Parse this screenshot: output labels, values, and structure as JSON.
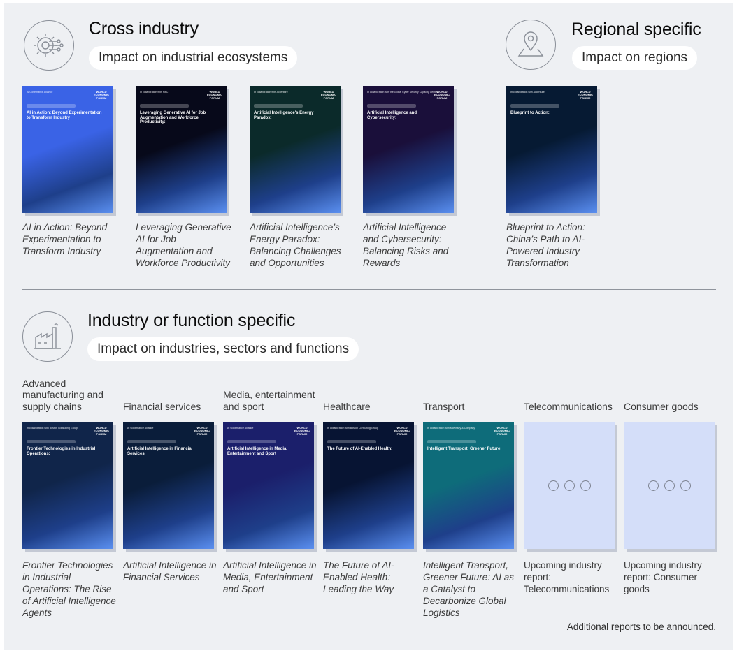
{
  "cross": {
    "title": "Cross industry",
    "subtitle": "Impact on industrial ecosystems",
    "icon": "gear-network-icon",
    "reports": [
      {
        "caption": "AI in Action: Beyond Experimentation to Transform Industry",
        "cover_head": "AI in Action: Beyond Experimentation to Transform Industry",
        "cover_small": "AI Governance Alliance",
        "bg": "#3a63e6"
      },
      {
        "caption": "Leveraging Generative AI for Job Augmentation and Workforce Productivity",
        "cover_head": "Leveraging Generative AI for Job Augmentation and Workforce Productivity:",
        "cover_small": "In collaboration with PwC",
        "bg": "#07091a"
      },
      {
        "caption": "Artificial Intelligence’s Energy Paradox: Balancing Challenges and Opportunities",
        "cover_head": "Artificial Intelligence’s Energy Paradox:",
        "cover_small": "In collaboration with Accenture",
        "bg": "#0b2a2a"
      },
      {
        "caption": "Artificial Intelligence and Cybersecurity: Balancing Risks and Rewards",
        "cover_head": "Artificial Intelligence and Cybersecurity:",
        "cover_small": "In collaboration with the Global Cyber Security Capacity Centre",
        "bg": "#1a0f3a"
      }
    ]
  },
  "regional": {
    "title": "Regional specific",
    "subtitle": "Impact on regions",
    "icon": "map-pin-icon",
    "reports": [
      {
        "caption": "Blueprint to Action: China’s Path to AI-Powered Industry Transformation",
        "cover_head": "Blueprint to Action:",
        "cover_small": "In collaboration with Accenture",
        "bg": "#061a33"
      }
    ]
  },
  "industry": {
    "title": "Industry or function specific",
    "subtitle": "Impact on industries, sectors and functions",
    "icon": "factory-icon",
    "columns": [
      {
        "heading": "Advanced manufacturing and supply chains",
        "caption": "Frontier Technologies in Industrial Operations: The Rise of Artificial Intelligence Agents",
        "cover_head": "Frontier Technologies in Industrial Operations:",
        "cover_small": "In collaboration with Boston Consulting Group",
        "bg": "#10254a",
        "upcoming": false
      },
      {
        "heading": "Financial services",
        "caption": "Artificial Intelligence in Financial Services",
        "cover_head": "Artificial Intelligence in Financial Services",
        "cover_small": "AI Governance Alliance",
        "bg": "#0a1d3a",
        "upcoming": false
      },
      {
        "heading": "Media, entertainment and sport",
        "caption": "Artificial Intelligence in Media, Entertainment and Sport",
        "cover_head": "Artificial Intelligence in Media, Entertainment and Sport",
        "cover_small": "AI Governance Alliance",
        "bg": "#1b1f6b",
        "upcoming": false
      },
      {
        "heading": "Healthcare",
        "caption": "The Future of AI-Enabled Health: Leading the Way",
        "cover_head": "The Future of AI-Enabled Health:",
        "cover_small": "In collaboration with Boston Consulting Group",
        "bg": "#071433",
        "upcoming": false
      },
      {
        "heading": "Transport",
        "caption": "Intelligent Transport, Greener Future: AI as a Catalyst to Decarbonize Global Logistics",
        "cover_head": "Intelligent Transport, Greener Future:",
        "cover_small": "In collaboration with McKinsey & Company",
        "bg": "#0e6c7a",
        "upcoming": false
      },
      {
        "heading": "Telecommunications",
        "caption": "Upcoming industry report: Telecommunications",
        "upcoming": true
      },
      {
        "heading": "Consumer goods",
        "caption": "Upcoming industry report: Consumer goods",
        "upcoming": true
      }
    ]
  },
  "logo_text": "WORLD ECONOMIC FORUM",
  "footnote": "Additional reports to be announced."
}
